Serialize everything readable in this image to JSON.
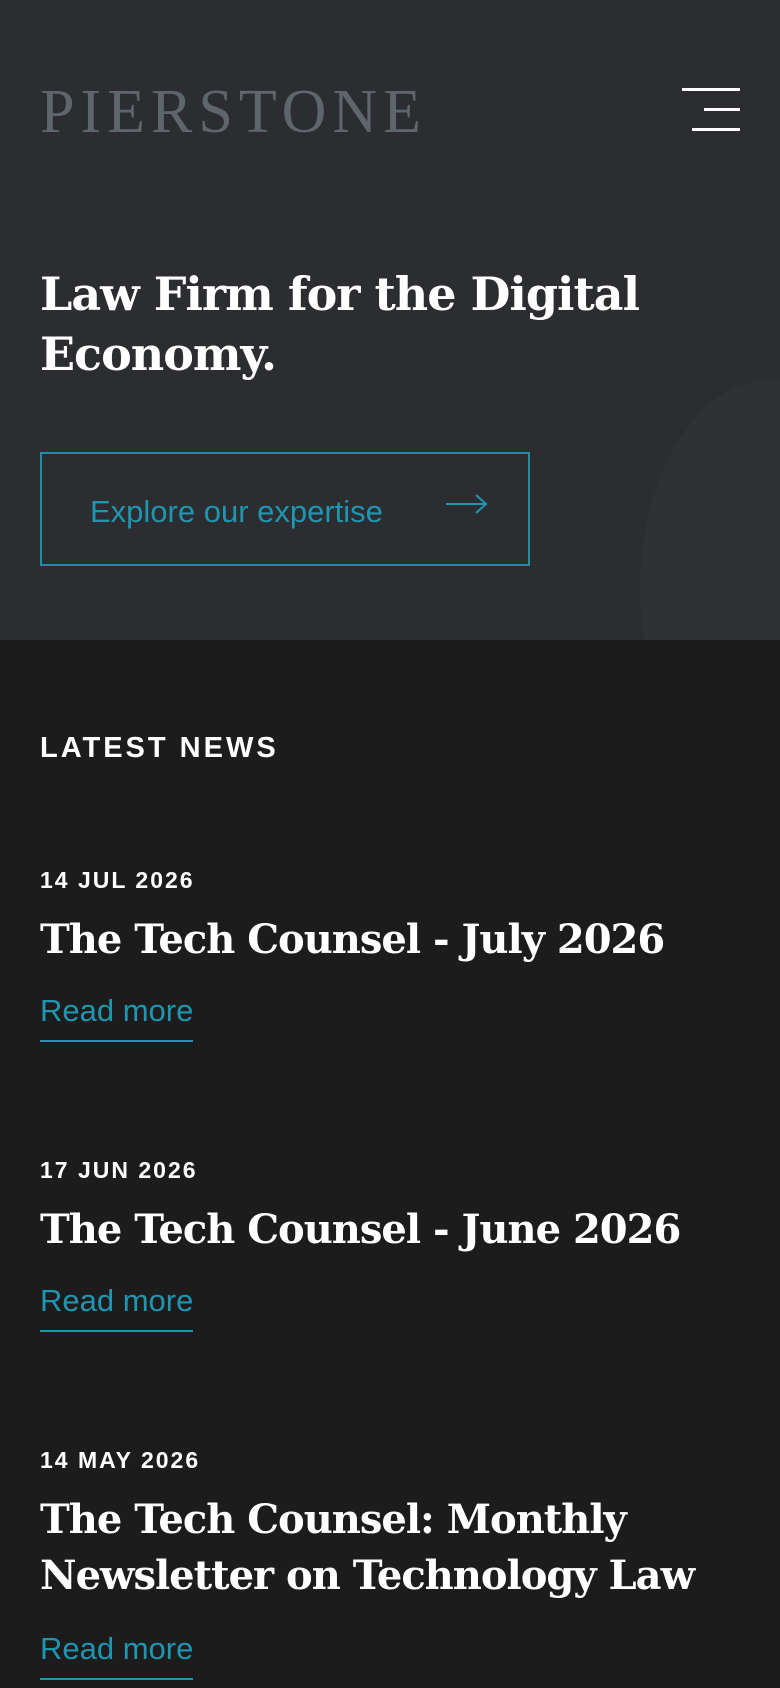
{
  "header": {
    "logo_text": "PIERSTONE",
    "menu_icon": "hamburger-menu-icon"
  },
  "hero": {
    "title": "Law Firm for the Digital Economy.",
    "cta_label": "Explore our expertise",
    "cta_icon": "arrow-right-icon"
  },
  "news": {
    "heading": "LATEST NEWS",
    "items": [
      {
        "date": "14 JUL 2026",
        "title": "The Tech Counsel - July 2026",
        "link_label": "Read more"
      },
      {
        "date": "17 JUN 2026",
        "title": "The Tech Counsel - June 2026",
        "link_label": "Read more"
      },
      {
        "date": "14 MAY 2026",
        "title": "The Tech Counsel: Monthly Newsletter on Technology Law",
        "link_label": "Read more"
      }
    ]
  },
  "colors": {
    "hero_background": "#2c2d30",
    "page_background": "#1c1c1d",
    "accent": "#1f95b0",
    "logo": "#5f666b",
    "text": "#ffffff"
  }
}
